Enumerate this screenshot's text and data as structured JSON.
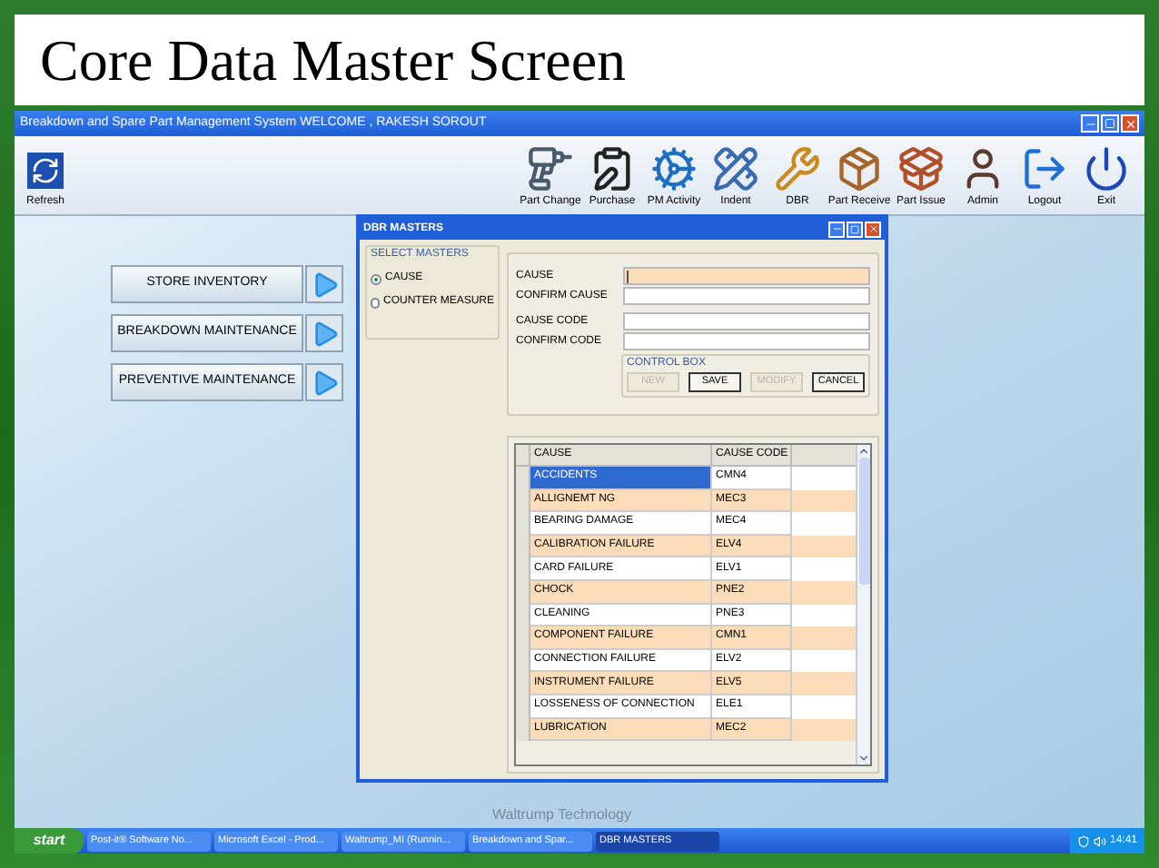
{
  "slide": {
    "title": "Core Data Master Screen",
    "caption": "Waltrump Technology"
  },
  "window": {
    "title": "Breakdown and Spare Part Management System WELCOME , RAKESH SOROUT"
  },
  "toolbar_left": [
    {
      "label": "Refresh"
    }
  ],
  "toolbar": [
    {
      "label": "Part Change"
    },
    {
      "label": "Purchase"
    },
    {
      "label": "PM Activity"
    },
    {
      "label": "Indent"
    },
    {
      "label": "DBR"
    },
    {
      "label": "Part Receive"
    },
    {
      "label": "Part Issue"
    },
    {
      "label": "Admin"
    },
    {
      "label": "Logout"
    },
    {
      "label": "Exit"
    }
  ],
  "menu_buttons": [
    "STORE INVENTORY",
    "BREAKDOWN MAINTENANCE",
    "PREVENTIVE MAINTENANCE"
  ],
  "dialog": {
    "title": "DBR MASTERS",
    "select_masters": {
      "legend": "SELECT MASTERS",
      "options": [
        {
          "label": "CAUSE",
          "selected": true
        },
        {
          "label": "COUNTER MEASURE",
          "selected": false
        }
      ]
    },
    "fields": [
      {
        "label": "CAUSE",
        "focused": true
      },
      {
        "label": "CONFIRM CAUSE",
        "focused": false
      },
      {
        "label": "CAUSE CODE",
        "focused": false
      },
      {
        "label": "CONFIRM CODE",
        "focused": false
      }
    ],
    "control_box": {
      "legend": "CONTROL BOX",
      "buttons": [
        {
          "label": "NEW",
          "disabled": true
        },
        {
          "label": "SAVE",
          "disabled": false
        },
        {
          "label": "MODIFY",
          "disabled": true
        },
        {
          "label": "CANCEL",
          "disabled": false
        }
      ]
    },
    "table": {
      "columns": [
        "CAUSE",
        "CAUSE CODE"
      ],
      "rows": [
        {
          "cells": [
            "ACCIDENTS",
            "CMN4"
          ],
          "selected": true
        },
        {
          "cells": [
            "ALLIGNEMT NG",
            "MEC3"
          ],
          "selected": false
        },
        {
          "cells": [
            "BEARING DAMAGE",
            "MEC4"
          ],
          "selected": false
        },
        {
          "cells": [
            "CALIBRATION FAILURE",
            "ELV4"
          ],
          "selected": false
        },
        {
          "cells": [
            "CARD FAILURE",
            "ELV1"
          ],
          "selected": false
        },
        {
          "cells": [
            "CHOCK",
            "PNE2"
          ],
          "selected": false
        },
        {
          "cells": [
            "CLEANING",
            "PNE3"
          ],
          "selected": false
        },
        {
          "cells": [
            "COMPONENT FAILURE",
            "CMN1"
          ],
          "selected": false
        },
        {
          "cells": [
            "CONNECTION FAILURE",
            "ELV2"
          ],
          "selected": false
        },
        {
          "cells": [
            "INSTRUMENT FAILURE",
            "ELV5"
          ],
          "selected": false
        },
        {
          "cells": [
            "LOSSENESS OF CONNECTION",
            "ELE1"
          ],
          "selected": false
        },
        {
          "cells": [
            "LUBRICATION",
            "MEC2"
          ],
          "selected": false
        }
      ]
    }
  },
  "taskbar": {
    "start": "start",
    "items": [
      {
        "label": "Post-it® Software No...",
        "selected": false
      },
      {
        "label": "Microsoft Excel - Prod...",
        "selected": false
      },
      {
        "label": "Waltrump_MI (Runnin...",
        "selected": false
      },
      {
        "label": "Breakdown and Spar...",
        "selected": false
      },
      {
        "label": "DBR MASTERS",
        "selected": true
      }
    ],
    "clock": "14:41"
  }
}
